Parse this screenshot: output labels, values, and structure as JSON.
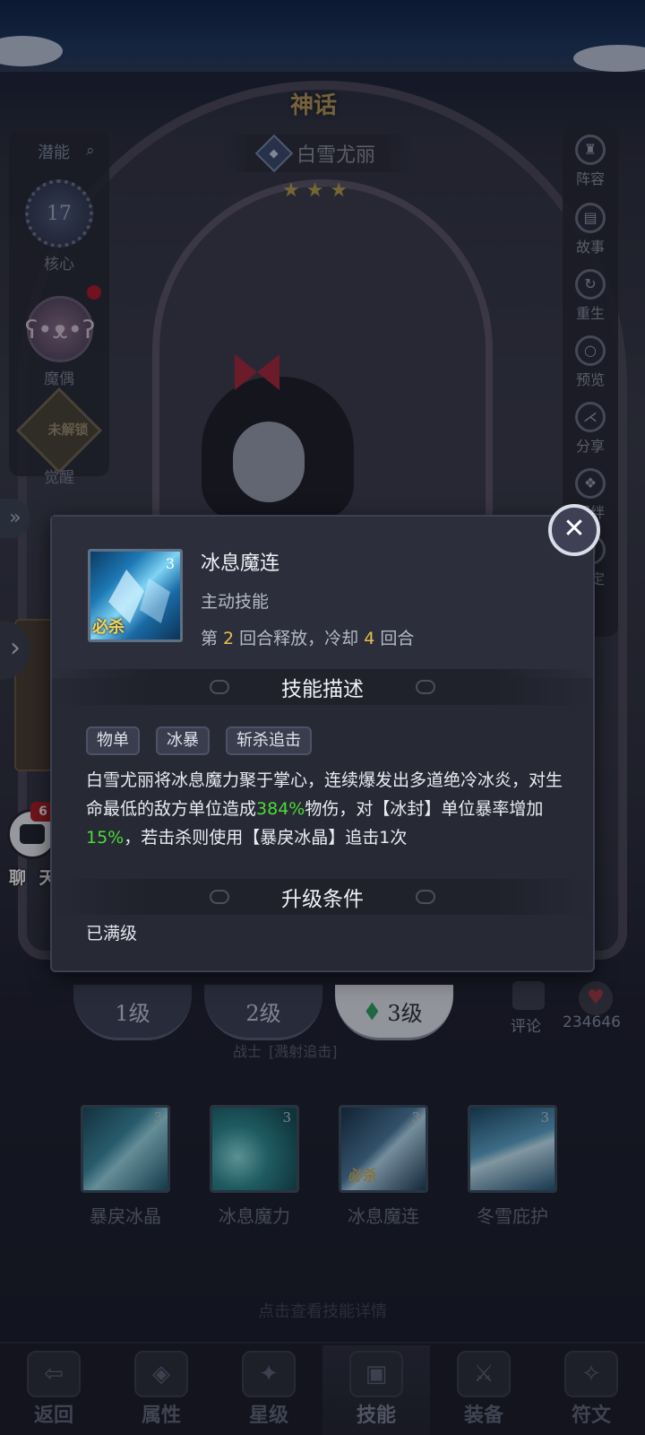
{
  "header": {
    "rarity": "神话",
    "hero_name": "白雪尤丽",
    "element_glyph": "◆",
    "stars": "★ ★ ★"
  },
  "left_menu": {
    "potential": "潜能",
    "search_glyph": "⌕",
    "core_value": "17",
    "core": "核心",
    "puppet": "魔偶",
    "puppet_glyph": "ʕ•ᴥ•ʔ",
    "locked": "未解锁",
    "awaken": "觉醒"
  },
  "right_menu": [
    "阵容",
    "故事",
    "重生",
    "预览",
    "分享",
    "羁绊",
    "锁定"
  ],
  "chat": {
    "label": "聊 天",
    "badge": "6"
  },
  "skill_popup": {
    "icon_level": "3",
    "icon_tag": "必杀",
    "name": "冰息魔连",
    "type": "主动技能",
    "timing_prefix": "第 ",
    "timing_round": "2",
    "timing_mid": " 回合释放，冷却 ",
    "timing_cd": "4",
    "timing_suffix": " 回合",
    "desc_heading": "技能描述",
    "tags": [
      "物单",
      "冰暴",
      "斩杀追击"
    ],
    "desc_part1": "白雪尤丽将冰息魔力聚于掌心，连续爆发出多道绝冷冰炎，对生命最低的敌方单位造成",
    "desc_val1": "384%",
    "desc_part2": "物伤，对【冰封】单位暴率增加",
    "desc_val2": "15%",
    "desc_part3": "，若击杀则使用【暴戾冰晶】追击1次",
    "upgrade_heading": "升级条件",
    "upgrade_status": "已满级",
    "close_glyph": "✕"
  },
  "level_tabs": [
    "1级",
    "2级",
    "3级"
  ],
  "social": {
    "comment": "评论",
    "likes": "234646",
    "heart_glyph": "♥"
  },
  "class_tag": {
    "class": "战士",
    "skill": "[溅射追击]"
  },
  "skills": [
    {
      "name": "暴戾冰晶",
      "level": "3"
    },
    {
      "name": "冰息魔力",
      "level": "3"
    },
    {
      "name": "冰息魔连",
      "level": "3",
      "tag": "必杀"
    },
    {
      "name": "冬雪庇护",
      "level": "3"
    }
  ],
  "hint": "点击查看技能详情",
  "bottom_nav": [
    "返回",
    "属性",
    "星级",
    "技能",
    "装备",
    "符文"
  ],
  "nav_glyphs": [
    "⇦",
    "◈",
    "✦",
    "▣",
    "⚔",
    "✧"
  ],
  "edge_glyphs": [
    "»",
    "›"
  ],
  "colors": {
    "highlight_green": "#4cdb37",
    "number_gold": "#e6c14c",
    "badge_red": "#b01c26"
  }
}
